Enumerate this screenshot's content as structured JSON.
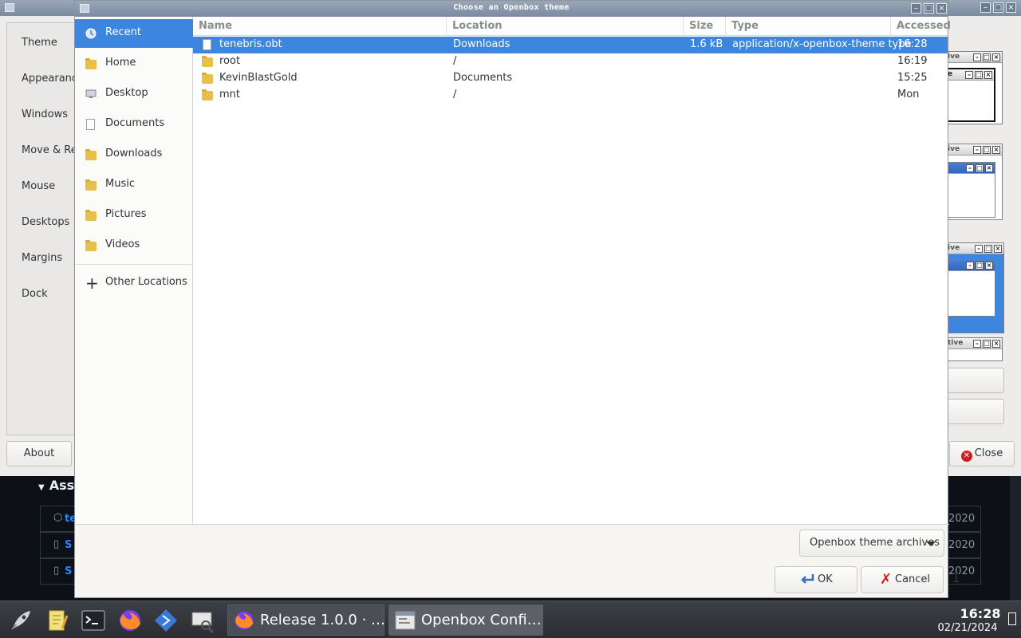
{
  "background_window": {
    "sidebar_items": [
      "Theme",
      "Appearance",
      "Windows",
      "Move & Resize",
      "Mouse",
      "Desktops",
      "Margins",
      "Dock"
    ],
    "about_label": "About",
    "close_label": "Close",
    "preview_labels": [
      "ive",
      "ive",
      "tive"
    ]
  },
  "web_fragment": {
    "heading": "Assets",
    "row_dates": [
      "2020",
      "2020",
      "2020"
    ],
    "row_prefixes": [
      "te",
      "S",
      "S"
    ]
  },
  "dialog": {
    "title": "Choose an Openbox theme",
    "places": [
      {
        "label": "Recent",
        "icon": "recent-icon",
        "selected": true
      },
      {
        "label": "Home",
        "icon": "home-folder-icon"
      },
      {
        "label": "Desktop",
        "icon": "desktop-icon"
      },
      {
        "label": "Documents",
        "icon": "documents-folder-icon"
      },
      {
        "label": "Downloads",
        "icon": "downloads-folder-icon"
      },
      {
        "label": "Music",
        "icon": "music-folder-icon"
      },
      {
        "label": "Pictures",
        "icon": "pictures-folder-icon"
      },
      {
        "label": "Videos",
        "icon": "videos-folder-icon"
      }
    ],
    "other_locations": "Other Locations",
    "columns": {
      "name": "Name",
      "location": "Location",
      "size": "Size",
      "type": "Type",
      "accessed": "Accessed"
    },
    "files": [
      {
        "name": "tenebris.obt",
        "location": "Downloads",
        "size": "1.6 kB",
        "type": "application/x-openbox-theme type",
        "accessed": "16:28",
        "icon": "file-icon",
        "selected": true
      },
      {
        "name": "root",
        "location": "/",
        "size": "",
        "type": "",
        "accessed": "16:19",
        "icon": "folder-icon"
      },
      {
        "name": "KevinBlastGold",
        "location": "Documents",
        "size": "",
        "type": "",
        "accessed": "15:25",
        "icon": "folder-icon"
      },
      {
        "name": "mnt",
        "location": "/",
        "size": "",
        "type": "",
        "accessed": "Mon",
        "icon": "folder-icon"
      }
    ],
    "filter_label": "Openbox theme archives",
    "ok_label": "OK",
    "cancel_label": "Cancel"
  },
  "taskbar": {
    "launchers": [
      "rocket-icon",
      "text-editor-icon",
      "terminal-icon",
      "firefox-icon",
      "app-icon",
      "screenshot-icon"
    ],
    "tasks": [
      {
        "label": "Release 1.0.0 · …",
        "icon": "firefox-icon"
      },
      {
        "label": "Openbox Confi…",
        "icon": "openbox-config-icon",
        "active": true
      }
    ],
    "time": "16:28",
    "date": "02/21/2024"
  },
  "colors": {
    "accent": "#3d86df",
    "titlebar": "#8796aa",
    "taskbar": "#2f3236"
  }
}
